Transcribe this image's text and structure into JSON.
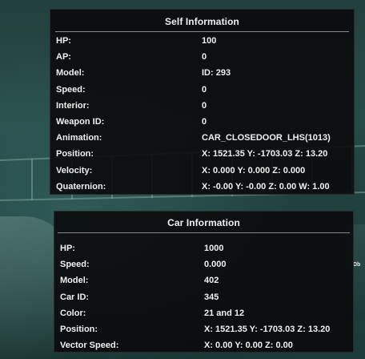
{
  "self_info": {
    "title": "Self Information",
    "rows": [
      {
        "label": "HP:",
        "value": "100"
      },
      {
        "label": "AP:",
        "value": "0"
      },
      {
        "label": "Model:",
        "value": "ID: 293"
      },
      {
        "label": "Speed:",
        "value": "0"
      },
      {
        "label": "Interior:",
        "value": "0"
      },
      {
        "label": "Weapon ID:",
        "value": "0"
      },
      {
        "label": "Animation:",
        "value": "CAR_CLOSEDOOR_LHS(1013)"
      },
      {
        "label": "Position:",
        "value": "X: 1521.35 Y: -1703.03 Z: 13.20"
      },
      {
        "label": "Velocity:",
        "value": "X: 0.000 Y: 0.000 Z: 0.000"
      },
      {
        "label": "Quaternion:",
        "value": "X: -0.00 Y: -0.00 Z: 0.00 W: 1.00"
      }
    ]
  },
  "car_info": {
    "title": "Car Information",
    "rows": [
      {
        "label": "HP:",
        "value": "1000"
      },
      {
        "label": "Speed:",
        "value": "0.000"
      },
      {
        "label": "Model:",
        "value": "402"
      },
      {
        "label": "Car ID:",
        "value": "345"
      },
      {
        "label": "Color:",
        "value": "21 and 12"
      },
      {
        "label": "Position:",
        "value": "X: 1521.35 Y: -1703.03 Z: 13.20"
      },
      {
        "label": "Vector Speed:",
        "value": "X: 0.00 Y: 0.00 Z: 0.00"
      }
    ]
  },
  "background": {
    "edge_text": "Db"
  }
}
